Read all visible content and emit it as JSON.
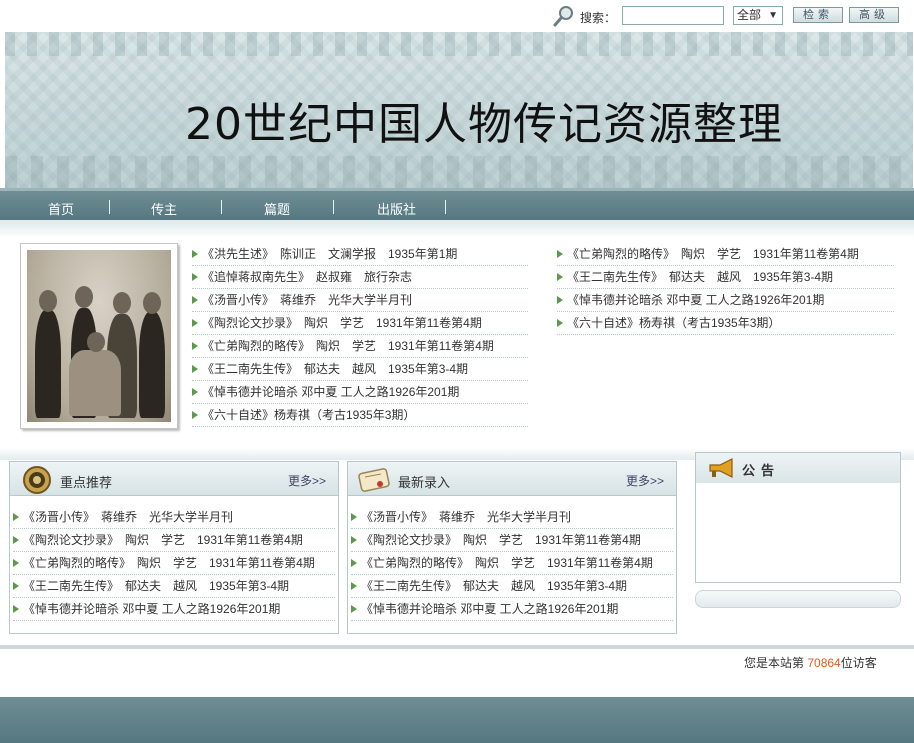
{
  "search": {
    "label": "搜索：",
    "value": "",
    "scope": "全部",
    "search_button": "检索",
    "advanced_button": "高级"
  },
  "banner": {
    "title": "20世纪中国人物传记资源整理"
  },
  "nav": {
    "items": [
      {
        "label": "首页"
      },
      {
        "label": "传主"
      },
      {
        "label": "篇题"
      },
      {
        "label": "出版社"
      }
    ]
  },
  "featured": {
    "left_list": [
      "《洪先生述》　陈训正　文澜学报　1935年第1期",
      "《追悼蒋叔南先生》　赵叔雍　旅行杂志",
      "《汤晋小传》　蒋维乔　光华大学半月刊",
      "《陶烈论文抄录》　陶炽　学艺　1931年第11卷第4期",
      "《亡弟陶烈的略传》　陶炽　学艺　1931年第11卷第4期",
      "《王二南先生传》　郁达夫　越风　1935年第3-4期",
      "《悼韦德并论暗杀 邓中夏 工人之路1926年201期",
      "《六十自述》杨寿祺（考古1935年3期）"
    ],
    "right_list": [
      "《亡弟陶烈的略传》　陶炽　学艺　1931年第11卷第4期",
      "《王二南先生传》　郁达夫　越风　1935年第3-4期",
      "《悼韦德并论暗杀 邓中夏 工人之路1926年201期",
      "《六十自述》杨寿祺（考古1935年3期）"
    ]
  },
  "recommend": {
    "title": "重点推荐",
    "more": "更多>>",
    "items": [
      "《汤晋小传》　蒋维乔　光华大学半月刊",
      "《陶烈论文抄录》　陶炽　学艺　1931年第11卷第4期",
      "《亡弟陶烈的略传》　陶炽　学艺　1931年第11卷第4期",
      "《王二南先生传》　郁达夫　越风　1935年第3-4期",
      "《悼韦德并论暗杀 邓中夏 工人之路1926年201期"
    ]
  },
  "latest": {
    "title": "最新录入",
    "more": "更多>>",
    "items": [
      "《汤晋小传》　蒋维乔　光华大学半月刊",
      "《陶烈论文抄录》　陶炽　学艺　1931年第11卷第4期",
      "《亡弟陶烈的略传》　陶炽　学艺　1931年第11卷第4期",
      "《王二南先生传》　郁达夫　越风　1935年第3-4期",
      "《悼韦德并论暗杀 邓中夏 工人之路1926年201期"
    ]
  },
  "notice": {
    "title": "公告"
  },
  "footer": {
    "visitor_prefix": "您是本站第",
    "visitor_count": "70864",
    "visitor_suffix": "位访客"
  },
  "colors": {
    "nav_bg": "#5f8088",
    "bullet": "#5a9a4a",
    "visitor_count": "#e05a1a"
  }
}
